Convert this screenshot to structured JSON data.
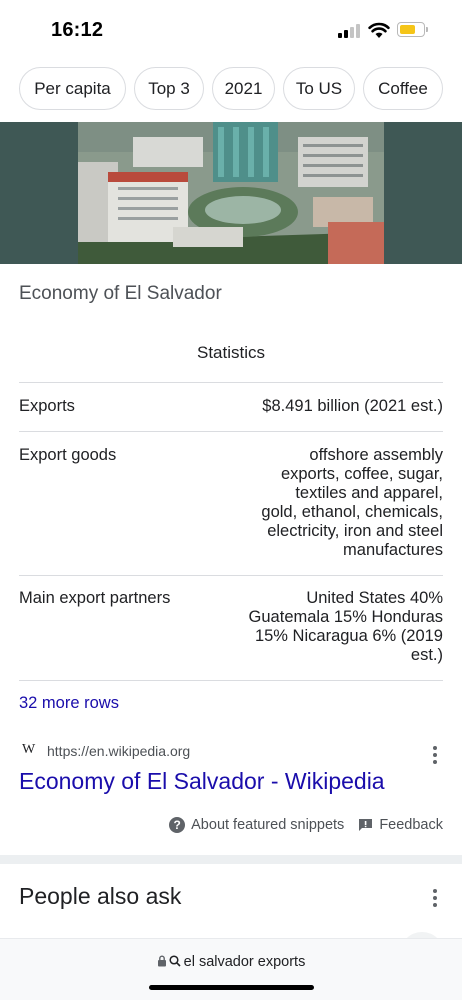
{
  "status_bar": {
    "time": "16:12"
  },
  "chips": [
    "Per capita",
    "Top 3",
    "2021",
    "To US",
    "Coffee"
  ],
  "knowledge_title": "Economy of El Salvador",
  "statistics": {
    "heading": "Statistics",
    "rows": [
      {
        "label": "Exports",
        "value_lines": [
          "$8.491 billion (2021 est.)"
        ]
      },
      {
        "label": "Export goods",
        "value_lines": [
          "offshore assembly",
          "exports, coffee, sugar,",
          "textiles and apparel,",
          "gold, ethanol, chemicals,",
          "electricity, iron and steel",
          "manufactures"
        ]
      },
      {
        "label": "Main export partners",
        "value_lines": [
          "United States 40%",
          "Guatemala 15% Honduras",
          "15% Nicaragua 6% (2019",
          "est.)"
        ]
      }
    ],
    "more_rows": "32 more rows"
  },
  "source": {
    "favicon": "W",
    "url": "https://en.wikipedia.org",
    "link_title": "Economy of El Salvador - Wikipedia"
  },
  "snippet_links": {
    "about": "About featured snippets",
    "feedback": "Feedback"
  },
  "people_also_ask": "People also ask",
  "address_bar": {
    "query": "el salvador exports"
  },
  "colors": {
    "link": "#1a0dab",
    "chip_border": "#dadce0",
    "hero_bg": "#3f5855",
    "battery": "#f5c518"
  }
}
